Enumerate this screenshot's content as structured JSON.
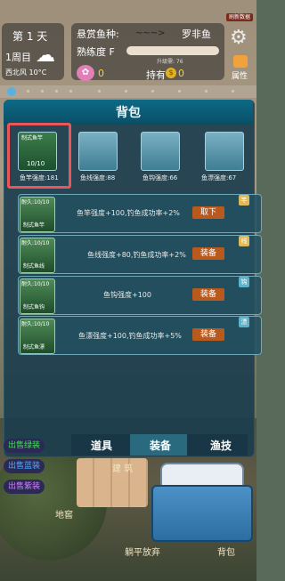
{
  "hud": {
    "day": "第 1 天",
    "week": "1周目",
    "wind": "西北风 10°C",
    "bounty_label": "悬赏鱼种:",
    "bounty_fish": "罗非鱼",
    "skill_label": "熟练度 F",
    "exp": "升级需: 76",
    "pink_count": "0",
    "hold_label": "持有",
    "coin_count": "0",
    "refresh_btn": "刷新数据",
    "attr_label": "属性"
  },
  "panel": {
    "title": "背包"
  },
  "slots": [
    {
      "name": "制式鱼竿",
      "count": "10/10",
      "label": "鱼竿强度:181"
    },
    {
      "label": "鱼线强度:88"
    },
    {
      "label": "鱼钩强度:66"
    },
    {
      "label": "鱼漂强度:67"
    }
  ],
  "equip": [
    {
      "durability": "耐久:10/10",
      "name": "制式鱼竿",
      "desc": "鱼竿强度+100,钓鱼成功率+2%",
      "button": "取下",
      "tag": "竿"
    },
    {
      "durability": "耐久:10/10",
      "name": "制式鱼线",
      "desc": "鱼线强度+80,钓鱼成功率+2%",
      "button": "装备",
      "tag": "线"
    },
    {
      "durability": "耐久:10/10",
      "name": "制式鱼钩",
      "desc": "鱼钩强度+100",
      "button": "装备",
      "tag": "钩"
    },
    {
      "durability": "耐久:10/10",
      "name": "制式鱼漂",
      "desc": "鱼漂强度+100,钓鱼成功率+5%",
      "button": "装备",
      "tag": "漂"
    }
  ],
  "tabs": [
    "道具",
    "装备",
    "渔技"
  ],
  "sell": [
    {
      "label": "出售绿装",
      "color": "#44dd55"
    },
    {
      "label": "出售蓝装",
      "color": "#4fa8ff"
    },
    {
      "label": "出售紫装",
      "color": "#d07bff"
    }
  ],
  "buildings": {
    "build": "建 筑",
    "cellar": "地窖",
    "lie_flat": "躺平放弃",
    "bag": "背包"
  }
}
